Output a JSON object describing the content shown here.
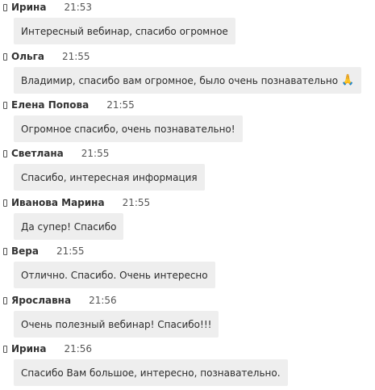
{
  "messages": [
    {
      "author": "Ирина",
      "time": "21:53",
      "text": "Интересный вебинар, спасибо огромное"
    },
    {
      "author": "Ольга",
      "time": "21:55",
      "text": "Владимир, спасибо вам огромное, было очень познавательно",
      "emoji": "🙏"
    },
    {
      "author": "Елена Попова",
      "time": "21:55",
      "text": "Огромное спасибо, очень познавательно!"
    },
    {
      "author": "Светлана",
      "time": "21:55",
      "text": "Спасибо, интересная информация"
    },
    {
      "author": "Иванова Марина",
      "time": "21:55",
      "text": "Да супер! Спасибо"
    },
    {
      "author": "Вера",
      "time": "21:55",
      "text": "Отлично. Спасибо. Очень интересно"
    },
    {
      "author": "Ярославна",
      "time": "21:56",
      "text": "Очень полезный вебинар! Спасибо!!!"
    },
    {
      "author": "Ирина",
      "time": "21:56",
      "text": "Спасибо Вам большое, интересно, познавательно."
    }
  ]
}
